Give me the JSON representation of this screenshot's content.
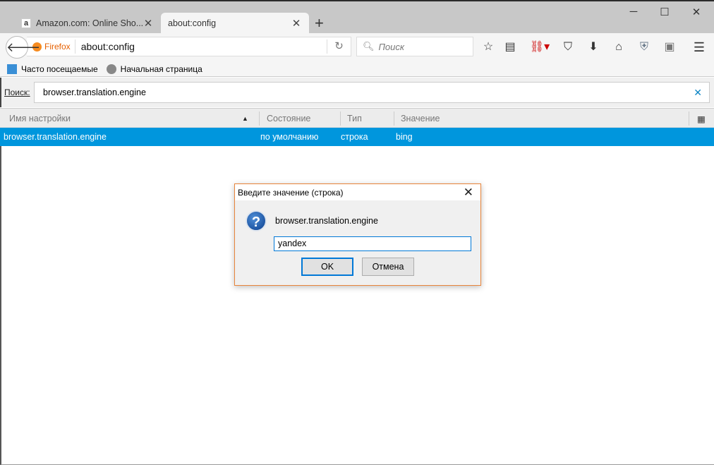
{
  "tabs": [
    {
      "label": "Amazon.com: Online Sho...",
      "favicon": "a"
    },
    {
      "label": "about:config"
    }
  ],
  "nav": {
    "identity": "Firefox",
    "url": "about:config",
    "search_placeholder": "Поиск"
  },
  "bookmarks": [
    {
      "label": "Часто посещаемые"
    },
    {
      "label": "Начальная страница"
    }
  ],
  "filter": {
    "label": "Поиск:",
    "value": "browser.translation.engine"
  },
  "columns": [
    "Имя настройки",
    "Состояние",
    "Тип",
    "Значение"
  ],
  "rows": [
    {
      "name": "browser.translation.engine",
      "status": "по умолчанию",
      "type": "строка",
      "value": "bing"
    }
  ],
  "dialog": {
    "title": "Введите значение (строка)",
    "message": "browser.translation.engine",
    "value": "yandex",
    "ok": "OK",
    "cancel": "Отмена"
  },
  "colors": {
    "selection": "#0096dd",
    "accent": "#0078d7",
    "dialog_border": "#e8843a"
  }
}
